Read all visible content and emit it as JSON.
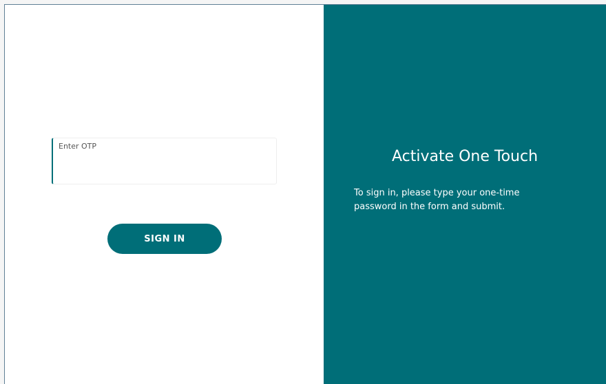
{
  "login_form": {
    "otp_label": "Enter OTP",
    "otp_value": "",
    "submit_label": "SIGN IN"
  },
  "info_panel": {
    "title": "Activate One Touch",
    "description": "To sign in, please type your one-time password in the form and submit."
  },
  "colors": {
    "accent": "#006e78",
    "background": "#ffffff"
  }
}
